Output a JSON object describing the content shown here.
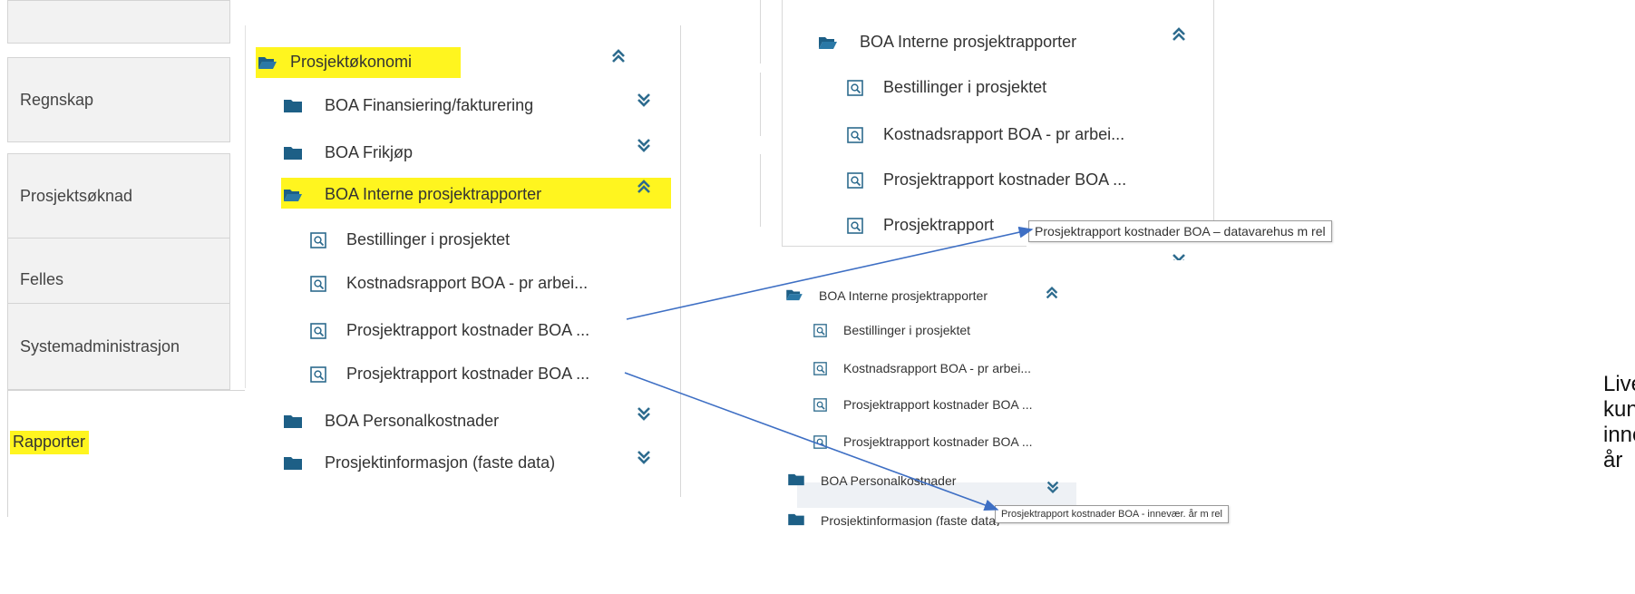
{
  "nav": {
    "items": [
      "Regnskap",
      "Prosjektsøknad",
      "Felles",
      "Systemadministrasjon"
    ],
    "active": "Rapporter"
  },
  "panel1": {
    "rows": [
      {
        "kind": "folder-open",
        "label": "Prosjektøkonomi",
        "chevron": "up"
      },
      {
        "kind": "folder",
        "label": "BOA Finansiering/fakturering",
        "chevron": "down"
      },
      {
        "kind": "folder",
        "label": "BOA Frikjøp",
        "chevron": "down"
      },
      {
        "kind": "folder-open",
        "label": "BOA Interne prosjektrapporter",
        "chevron": "up"
      },
      {
        "kind": "report",
        "label": "Bestillinger i prosjektet"
      },
      {
        "kind": "report",
        "label": "Kostnadsrapport BOA - pr arbei..."
      },
      {
        "kind": "report",
        "label": "Prosjektrapport kostnader BOA ..."
      },
      {
        "kind": "report",
        "label": "Prosjektrapport kostnader BOA ..."
      },
      {
        "kind": "folder",
        "label": "BOA Personalkostnader",
        "chevron": "down"
      },
      {
        "kind": "folder",
        "label": "Prosjektinformasjon (faste data)",
        "chevron": "down"
      }
    ]
  },
  "panel2": {
    "rows": [
      {
        "kind": "folder-open",
        "label": "BOA Interne prosjektrapporter",
        "chevron": "up"
      },
      {
        "kind": "report",
        "label": "Bestillinger i prosjektet"
      },
      {
        "kind": "report",
        "label": "Kostnadsrapport BOA - pr arbei..."
      },
      {
        "kind": "report",
        "label": "Prosjektrapport kostnader BOA ..."
      },
      {
        "kind": "report",
        "label": "Prosjektrapport"
      }
    ],
    "tooltip": "Prosjektrapport kostnader BOA – datavarehus m rel"
  },
  "panel3": {
    "rows": [
      {
        "kind": "folder-open",
        "label": "BOA Interne prosjektrapporter",
        "chevron": "up"
      },
      {
        "kind": "report",
        "label": "Bestillinger i prosjektet"
      },
      {
        "kind": "report",
        "label": "Kostnadsrapport BOA - pr arbei..."
      },
      {
        "kind": "report",
        "label": "Prosjektrapport kostnader BOA ..."
      },
      {
        "kind": "report",
        "label": "Prosjektrapport kostnader BOA ..."
      },
      {
        "kind": "folder",
        "label": "BOA Personalkostnader",
        "chevron": "down"
      },
      {
        "kind": "folder",
        "label": "Prosjektinformasjon (faste data)",
        "chevron": "down"
      }
    ],
    "tooltip": "Prosjektrapport kostnader BOA - innevær. år m rel"
  },
  "annotation": {
    "lines": [
      "Live",
      "kun",
      "inne",
      "år"
    ]
  },
  "colors": {
    "highlight": "#fff51f",
    "folder": "#1d5f86",
    "chevron": "#2d6b8e",
    "arrow": "#3e6fc4"
  }
}
